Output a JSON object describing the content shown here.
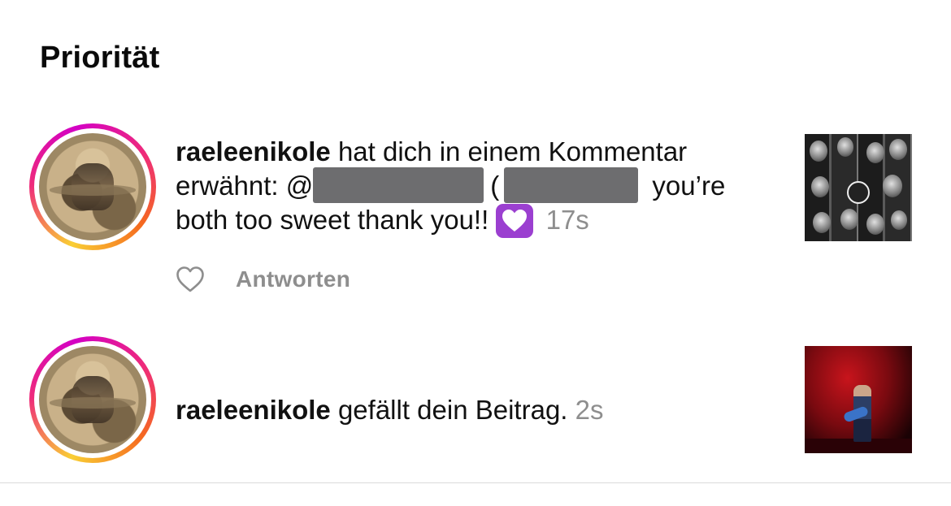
{
  "section": {
    "title": "Priorität"
  },
  "notifications": [
    {
      "username": "raeleenikole",
      "line1_text": " hat dich in einem Kommentar",
      "line2_prefix": "erwähnt: @",
      "line2_mid": "(",
      "line2_suffix": "you’re",
      "line3_text": "both too sweet thank you!! ",
      "emoji": "purple-heart",
      "time": "17s",
      "reply_label": "Antworten",
      "thumbnail": "black-and-white-photo-booth-collage"
    },
    {
      "username": "raeleenikole",
      "text": " gefällt dein Beitrag. ",
      "time": "2s",
      "thumbnail": "concert-performer-red-stage"
    }
  ],
  "colors": {
    "text": "#111111",
    "muted": "#8e8e8e",
    "story_ring_start": "#f9ce34",
    "story_ring_mid": "#ee2a7b",
    "redaction": "#6d6d6f",
    "divider": "#dbdbdb"
  }
}
